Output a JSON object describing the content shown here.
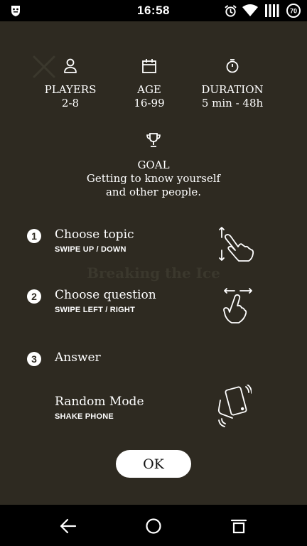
{
  "statusbar": {
    "time": "16:58",
    "badge": "70"
  },
  "stats": [
    {
      "label": "PLAYERS",
      "value": "2-8"
    },
    {
      "label": "AGE",
      "value": "16-99"
    },
    {
      "label": "DURATION",
      "value": "5 min - 48h"
    }
  ],
  "goal": {
    "label": "GOAL",
    "description": "Getting to know yourself and other people."
  },
  "watermark": "Breaking the Ice",
  "steps": [
    {
      "number": "1",
      "title": "Choose topic",
      "subtitle": "SWIPE UP / DOWN"
    },
    {
      "number": "2",
      "title": "Choose question",
      "subtitle": "SWIPE LEFT / RIGHT"
    },
    {
      "number": "3",
      "title": "Answer"
    }
  ],
  "random_mode": {
    "title": "Random Mode",
    "subtitle": "SHAKE PHONE"
  },
  "ok_label": "OK",
  "colors": {
    "background": "#2e2a21",
    "text": "#ffffff",
    "button": "#ffffff",
    "bars": "#000000"
  }
}
